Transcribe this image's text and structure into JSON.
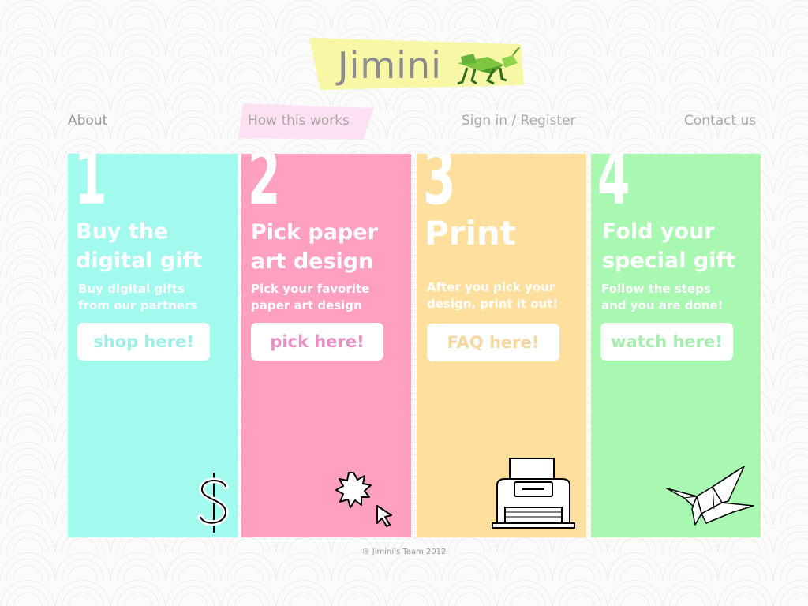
{
  "header": {
    "logo_text": "Jimini",
    "logo_icon": "grasshopper-icon",
    "logo_tape_color": "#f7f7a6"
  },
  "nav": {
    "about": "About",
    "how": "How this works",
    "sign": "Sign in / Register",
    "contact": "Contact us",
    "active_tape_color": "#fde0f1"
  },
  "steps": [
    {
      "number": "1",
      "title_line1": "Buy the",
      "title_line2": "digital gift",
      "sub_line1": "Buy digital gifts",
      "sub_line2": "from our partners",
      "button": "shop here!",
      "icon": "dollar-icon",
      "color": "#a2f9ee"
    },
    {
      "number": "2",
      "title_line1": "Pick paper",
      "title_line2": "art design",
      "sub_line1": "Pick your favorite",
      "sub_line2": "paper art design",
      "button": "pick here!",
      "icon": "click-cursor-icon",
      "color": "#ffa0c1"
    },
    {
      "number": "3",
      "title_line1": "Print",
      "title_line2": "",
      "sub_line1": "After you pick your",
      "sub_line2": "design, print it out!",
      "button": "FAQ here!",
      "icon": "printer-icon",
      "color": "#ffdf9e"
    },
    {
      "number": "4",
      "title_line1": "Fold your",
      "title_line2": "special gift",
      "sub_line1": "Follow the steps",
      "sub_line2": "and you are done!",
      "button": "watch here!",
      "icon": "origami-crane-icon",
      "color": "#a9f8b2"
    }
  ],
  "footer": {
    "text": "® Jimini's Team 2012"
  }
}
